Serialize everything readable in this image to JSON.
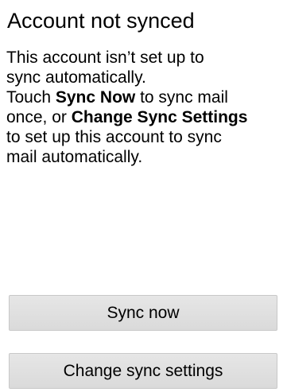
{
  "dialog": {
    "title": "Account not synced",
    "message": {
      "line1": "This account isn’t set up to",
      "line2": "sync automatically.",
      "line3_prefix": "Touch ",
      "line3_bold": "Sync Now",
      "line3_suffix": " to sync mail",
      "line4_prefix": "once, or ",
      "line4_bold": "Change Sync Settings",
      "line5": "to set up this account to sync",
      "line6": "mail automatically."
    },
    "buttons": {
      "sync_now": "Sync now",
      "change_settings": "Change sync settings"
    }
  }
}
